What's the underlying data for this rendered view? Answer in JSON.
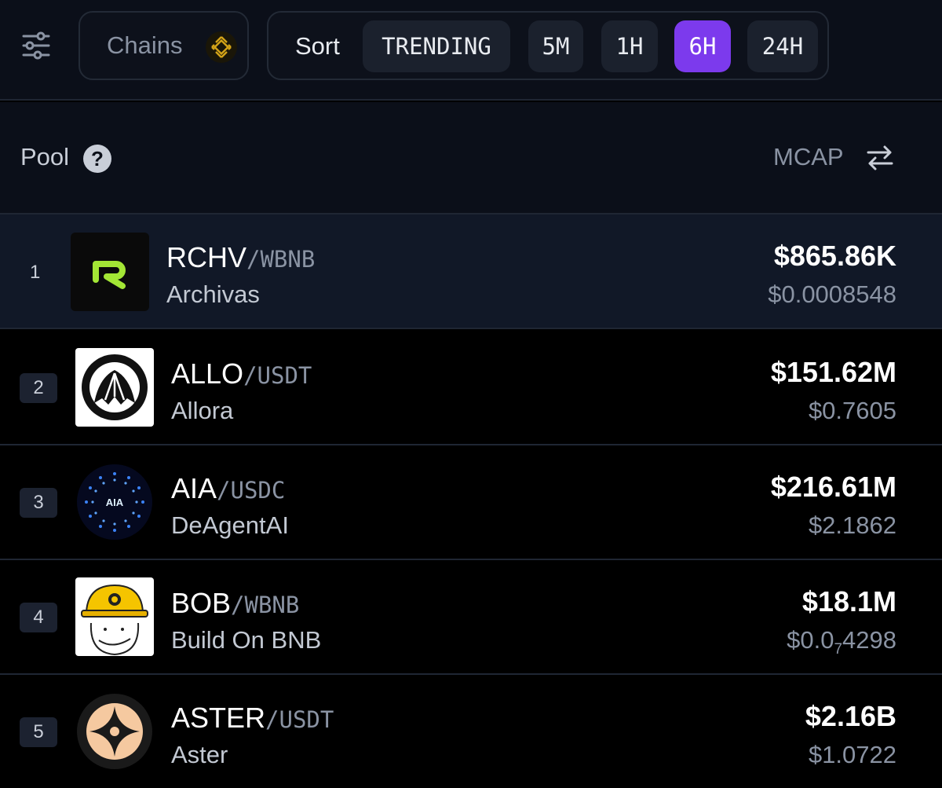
{
  "toolbar": {
    "filter_icon": "sliders-icon",
    "chains_label": "Chains",
    "chain_icon": "bnb-chain-icon",
    "sort_label": "Sort",
    "sort_options": [
      "TRENDING",
      "5M",
      "1H",
      "6H",
      "24H"
    ],
    "active_option": "6H",
    "accent_color": "#7c3aed"
  },
  "table_header": {
    "pool_label": "Pool",
    "help_icon": "question-circle-icon",
    "help_glyph": "?",
    "mcap_label": "MCAP",
    "swap_icon": "swap-arrows-icon"
  },
  "rows": [
    {
      "rank": "1",
      "base": "RCHV",
      "quote": "/WBNB",
      "name": "Archivas",
      "mcap": "$865.86K",
      "price": "$0.0008548",
      "logo_icon": "archivas-r-logo",
      "logo_text": "R"
    },
    {
      "rank": "2",
      "base": "ALLO",
      "quote": "/USDT",
      "name": "Allora",
      "mcap": "$151.62M",
      "price": "$0.7605",
      "logo_icon": "allora-logo"
    },
    {
      "rank": "3",
      "base": "AIA",
      "quote": "/USDC",
      "name": "DeAgentAI",
      "mcap": "$216.61M",
      "price": "$2.1862",
      "logo_icon": "deagentai-logo",
      "logo_text": "AIA"
    },
    {
      "rank": "4",
      "base": "BOB",
      "quote": "/WBNB",
      "name": "Build On BNB",
      "mcap": "$18.1M",
      "price_prefix": "$0.0",
      "price_sub": "7",
      "price_suffix": "4298",
      "logo_icon": "bob-hardhat-logo"
    },
    {
      "rank": "5",
      "base": "ASTER",
      "quote": "/USDT",
      "name": "Aster",
      "mcap": "$2.16B",
      "price": "$1.0722",
      "logo_icon": "aster-star-logo"
    }
  ]
}
